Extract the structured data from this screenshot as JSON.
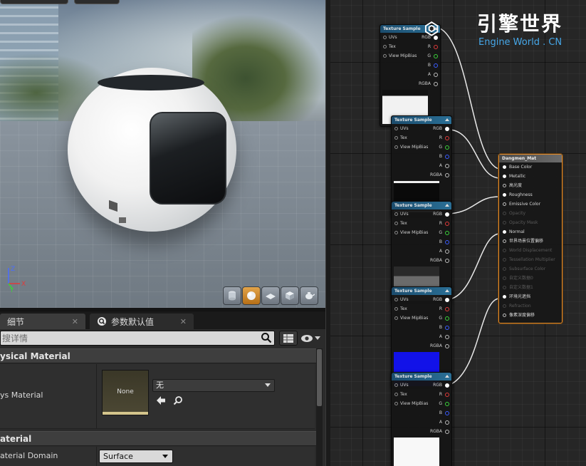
{
  "viewport": {
    "axis": {
      "z": "Z",
      "x": "X",
      "y": "Y"
    },
    "shape_buttons": [
      "cylinder-icon",
      "sphere-icon",
      "plane-icon",
      "cube-icon",
      "teapot-icon"
    ],
    "active_shape": "sphere-icon"
  },
  "details": {
    "tabs": [
      {
        "label": "细节",
        "icon": "details-icon"
      },
      {
        "label": "参数默认值",
        "icon": "search-icon"
      }
    ],
    "search": {
      "placeholder": "搜详情"
    },
    "categories": {
      "physical": "ysical Material",
      "material": "aterial"
    },
    "properties": {
      "phys_material": {
        "label": "ys Material",
        "thumb_label": "None",
        "value": "无"
      },
      "material_domain": {
        "label": "aterial Domain",
        "value": "Surface"
      }
    }
  },
  "graph": {
    "texture_nodes": [
      {
        "title": "Texture Sample",
        "inputs": [
          "UVs",
          "Tex",
          "View MipBias"
        ],
        "outputs": [
          "RGB",
          "R",
          "G",
          "B",
          "A",
          "RGBA"
        ],
        "preview": "white-with-dark-stripe"
      },
      {
        "title": "Texture Sample",
        "inputs": [
          "UVs",
          "Tex",
          "View MipBias"
        ],
        "outputs": [
          "RGB",
          "R",
          "G",
          "B",
          "A",
          "RGBA"
        ],
        "preview": "black-with-white-bands"
      },
      {
        "title": "Texture Sample",
        "inputs": [
          "UVs",
          "Tex",
          "View MipBias"
        ],
        "outputs": [
          "RGB",
          "R",
          "G",
          "B",
          "A",
          "RGBA"
        ],
        "preview": "gray"
      },
      {
        "title": "Texture Sample",
        "inputs": [
          "UVs",
          "Tex",
          "View MipBias"
        ],
        "outputs": [
          "RGB",
          "R",
          "G",
          "B",
          "A",
          "RGBA"
        ],
        "preview": "blue"
      },
      {
        "title": "Texture Sample",
        "inputs": [
          "UVs",
          "Tex",
          "View MipBias"
        ],
        "outputs": [
          "RGB",
          "R",
          "G",
          "B",
          "A",
          "RGBA"
        ],
        "preview": "white"
      }
    ],
    "material_node": {
      "title": "Dangmen_Mat",
      "inputs": [
        {
          "label": "Base Color",
          "state": "connected"
        },
        {
          "label": "Metallic",
          "state": "connected"
        },
        {
          "label": "高光度",
          "state": "enabled"
        },
        {
          "label": "Roughness",
          "state": "connected"
        },
        {
          "label": "Emissive Color",
          "state": "enabled"
        },
        {
          "label": "Opacity",
          "state": "disabled"
        },
        {
          "label": "Opacity Mask",
          "state": "disabled"
        },
        {
          "label": "Normal",
          "state": "connected"
        },
        {
          "label": "世界场景位置偏移",
          "state": "enabled"
        },
        {
          "label": "World Displacement",
          "state": "disabled"
        },
        {
          "label": "Tessellation Multiplier",
          "state": "disabled"
        },
        {
          "label": "Subsurface Color",
          "state": "disabled"
        },
        {
          "label": "自定义数据0",
          "state": "disabled"
        },
        {
          "label": "自定义数据1",
          "state": "disabled"
        },
        {
          "label": "环境光遮挡",
          "state": "connected"
        },
        {
          "label": "Refraction",
          "state": "disabled"
        },
        {
          "label": "像素深度偏移",
          "state": "enabled"
        }
      ]
    }
  },
  "watermark": {
    "title": "引擎世界",
    "subtitle": "Engine World . CN"
  },
  "colors": {
    "accent_orange": "#e08a2a",
    "node_header_blue": "#2a6f96",
    "pin_red": "#e03a3a",
    "pin_green": "#3ad23a",
    "pin_blue": "#3a5cff",
    "logo_blue": "#46a7e8"
  }
}
